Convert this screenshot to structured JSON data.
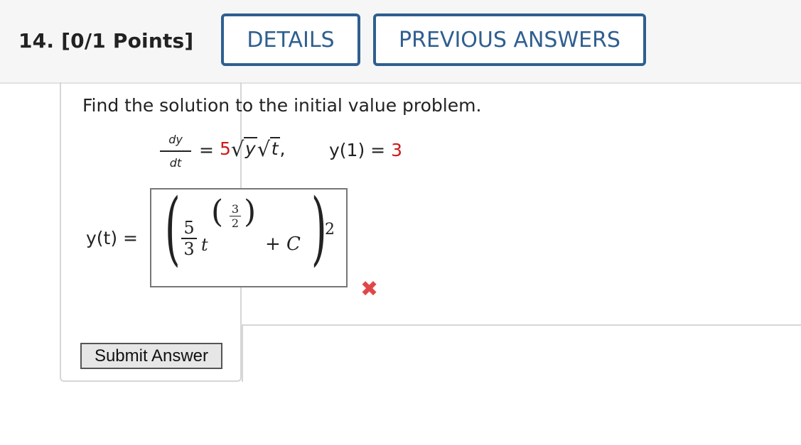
{
  "header": {
    "question": "14.  [0/1 Points]",
    "details_label": "DETAILS",
    "previous_label": "PREVIOUS ANSWERS"
  },
  "problem": {
    "prompt": "Find the solution to the initial value problem.",
    "lhs_num": "dy",
    "lhs_den": "dt",
    "equals": "=",
    "coefficient": "5",
    "sqrt_arg1": "y",
    "sqrt_arg2": "t",
    "comma": ",",
    "ic_left": "y(1) = ",
    "ic_value": "3"
  },
  "answer": {
    "label": "y(t) =",
    "frac_num": "5",
    "frac_den": "3",
    "var": "t",
    "exp_num": "3",
    "exp_den": "2",
    "plus_c": "+ C",
    "outer_exp": "2",
    "status_icon": "incorrect-x-icon",
    "status_color": "#e14747"
  },
  "submit_label": "Submit Answer",
  "colors": {
    "accent": "#2f5f8f",
    "highlight_red": "#d01818"
  }
}
